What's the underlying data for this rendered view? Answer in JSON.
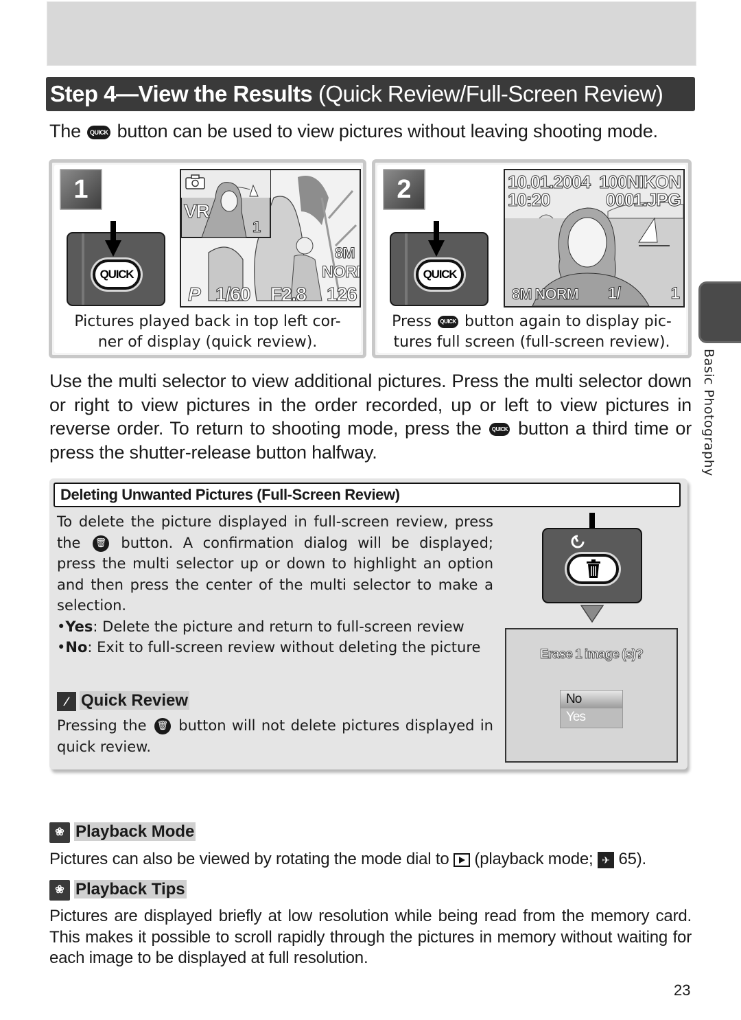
{
  "header": {
    "title_bold": "Step 4—View the Results",
    "title_sub": "(Quick Review/Full-Screen Review)"
  },
  "intro": {
    "before": "The",
    "icon": "QUICK",
    "after": "button can be used to view pictures without leaving shooting mode."
  },
  "steps": [
    {
      "number": "1",
      "button_label": "QUICK",
      "lcd": {
        "inset_top_right": "1",
        "vr": "VR",
        "size": "8M",
        "quality": "NORM",
        "mode": "P",
        "shutter": "1/60",
        "aperture": "F2.8",
        "remaining": "126"
      },
      "caption_line1": "Pictures played back in top left cor-",
      "caption_line2": "ner of display (quick review)."
    },
    {
      "number": "2",
      "button_label": "QUICK",
      "lcd": {
        "date": "10.01.2004",
        "time": "10:20",
        "folder": "100NIKON",
        "file": "0001.JPG",
        "size_quality": "8M NORM",
        "frame": "1/",
        "total": "1"
      },
      "caption_press": "Press",
      "caption_icon": "QUICK",
      "caption_line1_rest": "button again to display pic-",
      "caption_line2": "tures full screen (full-screen review)."
    }
  ],
  "body": {
    "p1_a": "Use the multi selector to view additional pictures.  Press the multi selector down or right to view pictures in the order recorded, up or left to view pictures in reverse order.  To return to shooting mode, press the",
    "p1_icon": "QUICK",
    "p1_b": "button a third time or press the shutter-release button halfway."
  },
  "delete_box": {
    "heading": "Deleting Unwanted Pictures (Full-Screen Review)",
    "text_a": "To delete the picture displayed in full-screen review, press the",
    "text_b": "button.  A confirmation dialog will be displayed; press the multi selector up or down to highlight an option and then press the center of the multi selector to make a selection.",
    "bullets": [
      {
        "term": "Yes",
        "desc": ": Delete the picture and return to full-screen review"
      },
      {
        "term": "No",
        "desc": ": Exit to full-screen review without deleting the picture"
      }
    ],
    "note_heading": "Quick Review",
    "note_a": "Pressing the",
    "note_b": "button will not delete pictures displayed in quick review.",
    "dialog": {
      "question": "Erase 1 image (s)?",
      "options": [
        "No",
        "Yes"
      ],
      "selected": "No"
    }
  },
  "tips": [
    {
      "heading": "Playback Mode",
      "text_a": "Pictures can also be viewed by rotating the mode dial to",
      "text_b": "(playback mode;",
      "ref_page": "65)."
    },
    {
      "heading": "Playback Tips",
      "text": "Pictures are displayed briefly at low resolution while being read from the memory card. This makes it possible to scroll rapidly through the pictures in memory without waiting for each image to be displayed at full resolution."
    }
  ],
  "side_tab": {
    "label": "Basic Photography"
  },
  "page_number": "23"
}
